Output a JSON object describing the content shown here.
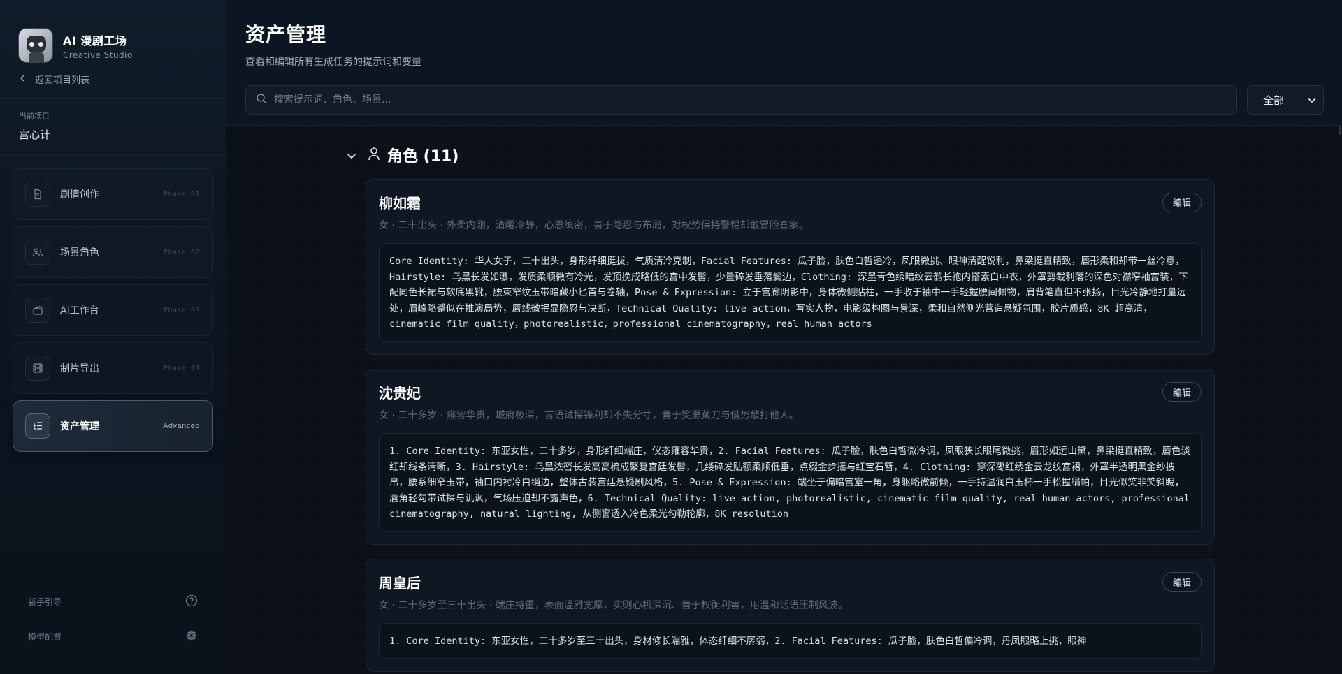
{
  "app": {
    "title": "AI 漫剧工场",
    "subtitle": "Creative Studio",
    "back_label": "返回项目列表"
  },
  "project": {
    "label": "当前项目",
    "name": "宫心计"
  },
  "nav": [
    {
      "label": "剧情创作",
      "phase": "Phase 01",
      "icon": "document-icon"
    },
    {
      "label": "场景角色",
      "phase": "Phase 02",
      "icon": "users-icon"
    },
    {
      "label": "AI工作台",
      "phase": "Phase 03",
      "icon": "clapper-icon"
    },
    {
      "label": "制片导出",
      "phase": "Phase 04",
      "icon": "film-icon"
    },
    {
      "label": "资产管理",
      "phase": "Advanced",
      "icon": "list-tree-icon",
      "active": true
    }
  ],
  "footer": {
    "guide_label": "新手引导",
    "model_label": "模型配置"
  },
  "header": {
    "title": "资产管理",
    "subtitle": "查看和编辑所有生成任务的提示词和变量",
    "search_placeholder": "搜索提示词、角色、场景...",
    "filter_value": "全部"
  },
  "group": {
    "title": "角色 (11)"
  },
  "cards": [
    {
      "name": "柳如霜",
      "edit_label": "编辑",
      "desc": "女 · 二十出头 · 外柔内刚，清醒冷静，心思缜密，善于隐忍与布局，对权势保持警惕却敢冒险查案。",
      "prompt": "Core Identity: 华人女子，二十出头，身形纤细挺拔，气质清冷克制，Facial Features: 瓜子脸，肤色白皙透冷，凤眼微挑、眼神清醒锐利，鼻梁挺直精致，唇形柔和却带一丝冷意，Hairstyle: 乌黑长发如瀑，发质柔顺微有冷光，发顶挽成略低的宫中发髻，少量碎发垂落鬓边，Clothing: 深墨青色绣暗纹云鹤长袍内搭素白中衣，外罩剪裁利落的深色对襟窄袖宫装，下配同色长裙与软底黑靴，腰束窄纹玉带暗藏小匕首与卷轴，Pose & Expression: 立于宫廊阴影中，身体微侧贴柱，一手收于袖中一手轻握腰间佩物，肩背笔直但不张扬，目光冷静地打量远处，眉峰略蹙似在推演局势，唇线微抿显隐忍与决断，Technical Quality: live-action，写实人物，电影级构图与景深，柔和自然侧光营造悬疑氛围，胶片质感，8K 超高清，cinematic film quality，photorealistic，professional cinematography，real human actors"
    },
    {
      "name": "沈贵妃",
      "edit_label": "编辑",
      "desc": "女 · 二十多岁 · 雍容华贵，城府极深，言语试探锋利却不失分寸，善于笑里藏刀与借势敲打他人。",
      "prompt": "1. Core Identity: 东亚女性，二十多岁，身形纤细端庄，仪态雍容华贵，2. Facial Features: 瓜子脸，肤色白皙微冷调，凤眼狭长眼尾微挑，眉形如远山黛，鼻梁挺直精致，唇色淡红却线条清晰，3. Hairstyle: 乌黑浓密长发高高梳成繁复宫廷发髻，几缕碎发贴额柔顺低垂，点缀金步摇与红宝石簪，4. Clothing: 穿深枣红绣金云龙纹宫裙，外罩半透明黑金纱披帛，腰系细窄玉带，袖口内衬冷白绡边，整体古装宫廷悬疑剧风格，5. Pose & Expression: 端坐于偏暗宫室一角，身躯略微前倾，一手持温润白玉杯一手松握绢帕，目光似笑非笑斜睨，唇角轻勾带试探与讥讽，气场压迫却不露声色，6. Technical Quality: live-action, photorealistic, cinematic film quality, real human actors, professional cinematography, natural lighting, 从侧窗透入冷色柔光勾勒轮廓，8K resolution"
    },
    {
      "name": "周皇后",
      "edit_label": "编辑",
      "desc": "女 · 二十多岁至三十出头 · 端庄持重，表面温雅宽厚，实则心机深沉、善于权衡利害，用温和话语压制风波。",
      "prompt": "1. Core Identity: 东亚女性，二十多岁至三十出头，身材修长端雅，体态纤细不孱弱，2. Facial Features: 瓜子脸，肤色白皙偏冷调，丹凤眼略上挑，眼神"
    }
  ]
}
